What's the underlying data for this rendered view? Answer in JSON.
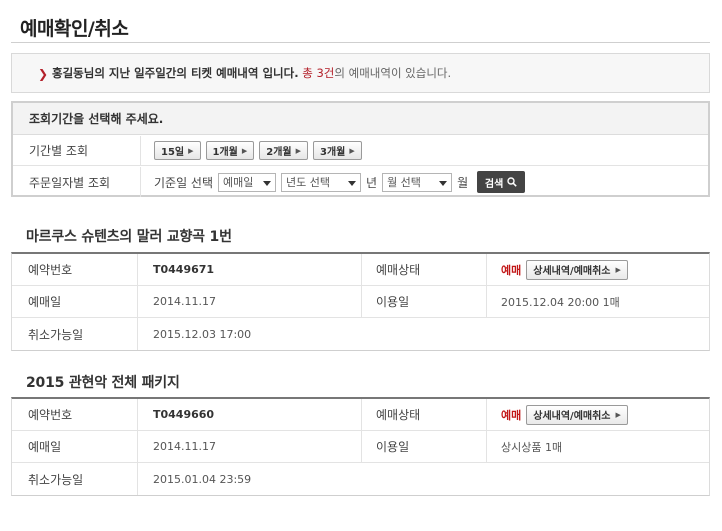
{
  "page": {
    "title": "예매확인/취소"
  },
  "notice": {
    "user_text": "홍길동님의 지난 일주일간의 티켓 예매내역 입니다.",
    "total_prefix": "총",
    "count": "3건",
    "suffix": "의 예매내역이 있습니다."
  },
  "search": {
    "heading": "조회기간을 선택해 주세요.",
    "period_label": "기간별 조회",
    "period_buttons": [
      "15일",
      "1개월",
      "2개월",
      "3개월"
    ],
    "order_label": "주문일자별 조회",
    "base_date_label": "기준일 선택",
    "base_date_value": "예매일",
    "year_value": "년도 선택",
    "year_unit": "년",
    "month_value": "월 선택",
    "month_unit": "월",
    "search_button": "검색"
  },
  "bookings": [
    {
      "title": "마르쿠스 슈텐츠의 말러 교향곡 1번",
      "labels": {
        "booking_no": "예약번호",
        "status": "예매상태",
        "booked_on": "예매일",
        "use_date": "이용일",
        "cancel_until": "취소가능일"
      },
      "booking_no": "T0449671",
      "status": "예매",
      "detail_button": "상세내역/예매취소",
      "booked_on": "2014.11.17",
      "use_date": "2015.12.04  20:00 1매",
      "cancel_until": "2015.12.03  17:00"
    },
    {
      "title": "2015 관현악 전체 패키지",
      "labels": {
        "booking_no": "예약번호",
        "status": "예매상태",
        "booked_on": "예매일",
        "use_date": "이용일",
        "cancel_until": "취소가능일"
      },
      "booking_no": "T0449660",
      "status": "예매",
      "detail_button": "상세내역/예매취소",
      "booked_on": "2014.11.17",
      "use_date": "상시상품 1매",
      "cancel_until": "2015.01.04  23:59"
    }
  ]
}
